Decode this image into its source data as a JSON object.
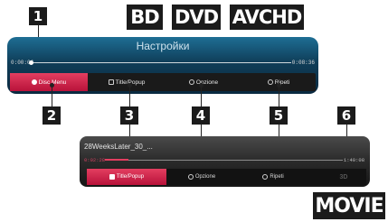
{
  "badges": {
    "bd": "BD",
    "dvd": "DVD",
    "avchd": "AVCHD",
    "movie": "MOVIE"
  },
  "callouts": [
    "1",
    "2",
    "3",
    "4",
    "5",
    "6"
  ],
  "menu_top": {
    "title": "Настройки",
    "time_elapsed": "0:00:06",
    "time_total": "0:08:36",
    "buttons": [
      {
        "label": "Disc Menu",
        "icon": "disc-icon",
        "selected": true
      },
      {
        "label": "Title/Popup",
        "icon": "title-icon",
        "selected": false
      },
      {
        "label": "Opzione",
        "icon": "option-icon",
        "selected": false
      },
      {
        "label": "Ripeti",
        "icon": "repeat-icon",
        "selected": false
      }
    ]
  },
  "menu_bottom": {
    "title": "28WeeksLater_30_...",
    "time_elapsed": "0:02:28",
    "time_total": "1:40:08",
    "buttons": [
      {
        "label": "Title/Popup",
        "icon": "title-icon",
        "selected": true
      },
      {
        "label": "Opzione",
        "icon": "option-icon",
        "selected": false
      },
      {
        "label": "Ripeti",
        "icon": "repeat-icon",
        "selected": false
      }
    ],
    "disabled_label": "3D"
  },
  "colors": {
    "accent": "#d3284e",
    "panel_blue": "#124a6a",
    "panel_dark": "#2a2a2a"
  }
}
